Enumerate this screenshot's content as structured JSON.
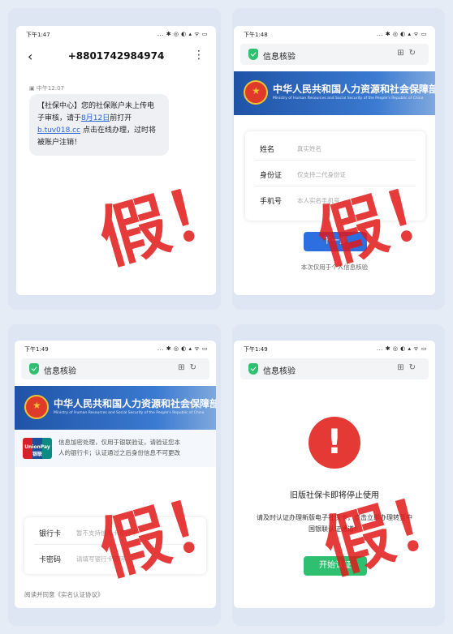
{
  "fake_mark": "假！",
  "status": {
    "icons": "... ✱ ◎ ◐ ▴ ᯤ ▭"
  },
  "sms": {
    "time": "下午1:47",
    "phone_number": "+8801742984974",
    "message_time": "中午12:07",
    "message_part1": "【社保中心】您的社保账户未上传电子审核，请于",
    "message_date": "8月12日",
    "message_part2": "前打开",
    "message_link": "b.tuv018.cc",
    "message_part3": "点击在线办理，过时将被账户注销！"
  },
  "verify": {
    "time": "下午1:48",
    "page_title": "信息核验",
    "ministry_cn": "中华人民共和国人力资源和社会保障部",
    "ministry_en": "Ministry of Human Resources and Social Security of the People's Republic of China",
    "fields": [
      {
        "label": "姓名",
        "placeholder": "真实姓名"
      },
      {
        "label": "身份证",
        "placeholder": "仅支持二代身份证"
      },
      {
        "label": "手机号",
        "placeholder": "本人实名手机号"
      }
    ],
    "next_button": "下一步",
    "note": "本次仅用于个人信息核验"
  },
  "bank": {
    "time": "下午1:49",
    "page_title": "信息核验",
    "ministry_cn": "中华人民共和国人力资源和社会保障部",
    "ministry_en": "Ministry of Human Resources and Social Security of the People's Republic of China",
    "unionpay": "UnionPay 银联",
    "info": "信息加密处理，仅用于银联验证，请验证您本人的银行卡；认证通过之后身份信息不可更改",
    "fields": [
      {
        "label": "银行卡",
        "placeholder": "暂不支持信用卡银行卡"
      },
      {
        "label": "卡密码",
        "placeholder": "请填写银行卡密码"
      }
    ],
    "agreement": "阅读并同意《实名认证协议》"
  },
  "warning": {
    "time": "下午1:49",
    "page_title": "信息核验",
    "headline": "旧版社保卡即将停止使用",
    "body": "请及时认证办理新版电子社保卡，点击立即办理转至中国银联认证通道！",
    "button": "开始认证"
  }
}
